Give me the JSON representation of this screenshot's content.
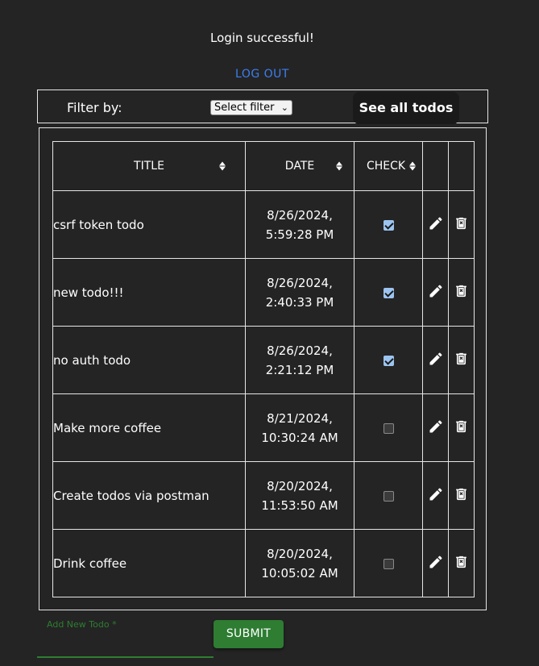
{
  "status_message": "Login successful!",
  "logout_label": "LOG OUT",
  "filter": {
    "label": "Filter by:",
    "select_value": "Select filter",
    "see_all_label": "See all todos"
  },
  "table": {
    "headers": [
      "TITLE",
      "DATE",
      "CHECK"
    ],
    "rows": [
      {
        "title": "csrf token todo",
        "date_line1": "8/26/2024,",
        "date_line2": "5:59:28 PM",
        "checked": true
      },
      {
        "title": "new todo!!!",
        "date_line1": "8/26/2024,",
        "date_line2": "2:40:33 PM",
        "checked": true
      },
      {
        "title": "no auth todo",
        "date_line1": "8/26/2024,",
        "date_line2": "2:21:12 PM",
        "checked": true
      },
      {
        "title": "Make more coffee",
        "date_line1": "8/21/2024,",
        "date_line2": "10:30:24 AM",
        "checked": false
      },
      {
        "title": "Create todos via postman",
        "date_line1": "8/20/2024,",
        "date_line2": "11:53:50 AM",
        "checked": false
      },
      {
        "title": "Drink coffee",
        "date_line1": "8/20/2024,",
        "date_line2": "10:05:02 AM",
        "checked": false
      }
    ]
  },
  "form": {
    "field_label": "Add New Todo *",
    "field_value": "",
    "submit_label": "SUBMIT"
  },
  "icons": {
    "sort": "sort-icon",
    "edit": "pencil-icon",
    "delete": "trash-icon",
    "select_chevron": "chevron-down-icon"
  },
  "colors": {
    "background": "#242424",
    "link": "#3b7ff0",
    "accent_green": "#2e7d32",
    "checkbox_checked": "#9cc4f0"
  }
}
